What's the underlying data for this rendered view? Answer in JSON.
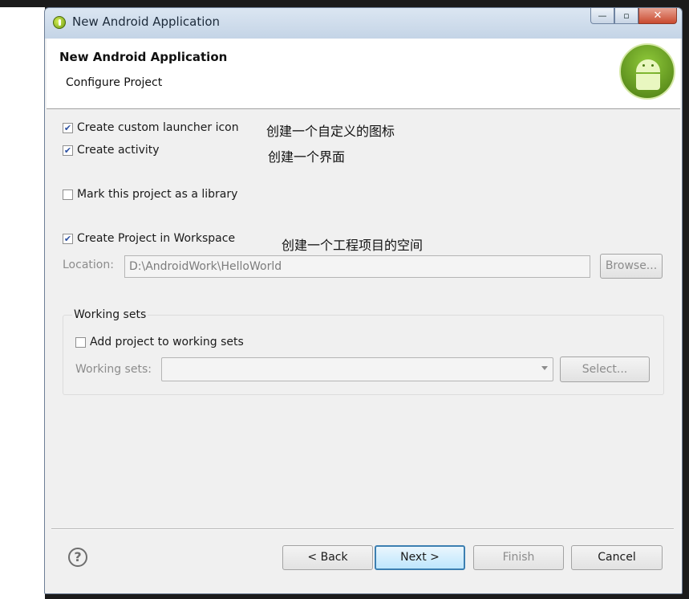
{
  "window": {
    "title": "New Android Application"
  },
  "titlebar_buttons": {
    "minimize": "—",
    "maximize": "▫",
    "close": "✕"
  },
  "header": {
    "title": "New Android Application",
    "subtitle": "Configure Project"
  },
  "options": [
    {
      "label": "Create custom launcher icon",
      "checked": true
    },
    {
      "label": "Create activity",
      "checked": true
    },
    {
      "label": "Mark this project as a library",
      "checked": false
    },
    {
      "label": "Create Project in Workspace",
      "checked": true
    }
  ],
  "annotations": {
    "launcher_icon": "创建一个自定义的图标",
    "activity": "创建一个界面",
    "workspace": "创建一个工程项目的空间"
  },
  "location": {
    "label": "Location:",
    "value": "D:\\AndroidWork\\HelloWorld",
    "browse_label": "Browse..."
  },
  "working_sets": {
    "group_title": "Working sets",
    "add_label": "Add project to working sets",
    "add_checked": false,
    "sets_label": "Working sets:",
    "sets_value": "",
    "select_label": "Select..."
  },
  "footer": {
    "help_icon": "?",
    "back_label": "< Back",
    "next_label": "Next >",
    "finish_label": "Finish",
    "cancel_label": "Cancel"
  }
}
